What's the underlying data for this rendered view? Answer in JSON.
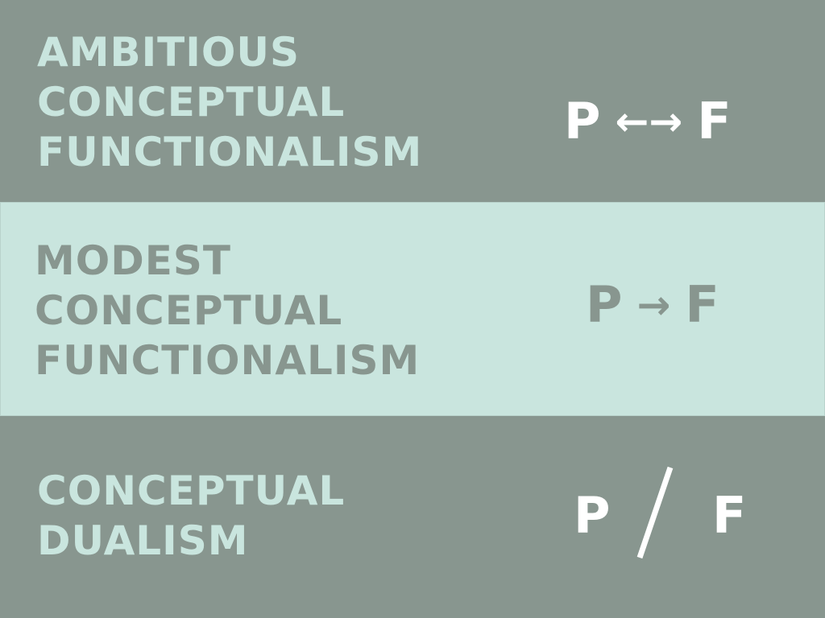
{
  "rows": [
    {
      "label_lines": [
        "AMBITIOUS",
        "CONCEPTUAL",
        "FUNCTIONALISM"
      ],
      "formula": {
        "left": "P",
        "connector": "←→",
        "right": "F"
      }
    },
    {
      "label_lines": [
        "MODEST",
        "CONCEPTUAL",
        "FUNCTIONALISM"
      ],
      "formula": {
        "left": "P",
        "connector": "→",
        "right": "F"
      }
    },
    {
      "label_lines": [
        "CONCEPTUAL",
        "DUALISM"
      ],
      "formula": {
        "left": "P",
        "connector": "/",
        "right": "F"
      }
    }
  ],
  "colors": {
    "dark_band": "#88968f",
    "light_band": "#c9e5de",
    "white": "#ffffff"
  }
}
